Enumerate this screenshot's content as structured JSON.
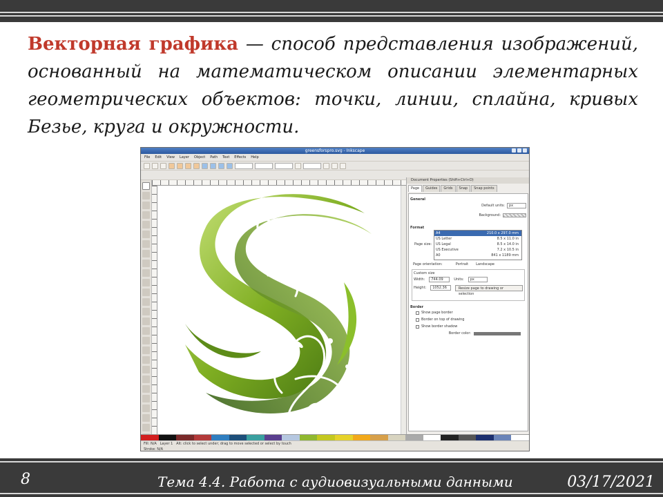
{
  "slide": {
    "term": "Векторная графика",
    "definition_rest": " — способ представления изображений, основанный на математическом описании элементарных геометрических объектов: точки, линии, сплайна, кривых Безье, круга и окружности.",
    "page_number": "8",
    "topic": "Тема 4.4. Работа с аудиовизуальными данными",
    "date": "03/17/2021",
    "accent_color": "#c0392b"
  },
  "screenshot": {
    "window_title": "greensforspro.svg - Inkscape",
    "menu": [
      "File",
      "Edit",
      "View",
      "Layer",
      "Object",
      "Path",
      "Text",
      "Effects",
      "Help"
    ],
    "dialog": {
      "title": "Document Properties (Shift+Ctrl+D)",
      "tabs": [
        "Page",
        "Guides",
        "Grids",
        "Snap",
        "Snap points"
      ],
      "general_label": "General",
      "default_units_label": "Default units:",
      "default_units_value": "px",
      "background_label": "Background:",
      "format_label": "Format",
      "page_size_label": "Page size:",
      "sizes": [
        {
          "name": "A4",
          "dims": "210.0 x 297.0 mm"
        },
        {
          "name": "US Letter",
          "dims": "8.5 x 11.0 in"
        },
        {
          "name": "US Legal",
          "dims": "8.5 x 14.0 in"
        },
        {
          "name": "US Executive",
          "dims": "7.2 x 10.5 in"
        },
        {
          "name": "A0",
          "dims": "841 x 1189 mm"
        }
      ],
      "orientation_label": "Page orientation:",
      "portrait": "Portrait",
      "landscape": "Landscape",
      "custom_size_label": "Custom size",
      "width_label": "Width:",
      "width_value": "744.09",
      "height_label": "Height:",
      "height_value": "1052.36",
      "units_label": "Units:",
      "units_value": "px",
      "resize_button": "Resize page to drawing or selection",
      "border_label": "Border",
      "show_border": "Show page border",
      "border_on_top": "Border on top of drawing",
      "show_shadow": "Show border shadow",
      "border_color_label": "Border color:"
    },
    "status_layer": "Layer 1",
    "status_text": "Alt: click to select under; drag to move selected or select by touch",
    "status_fill_label": "Fill:",
    "status_stroke_label": "Stroke:",
    "status_na": "N/A",
    "palette": [
      "#d21f1f",
      "#111111",
      "#7a2a2a",
      "#b33a3a",
      "#2f7ec0",
      "#1d4f7a",
      "#3aa0a0",
      "#5a3f8f",
      "#b5c7e0",
      "#90b830",
      "#c4c820",
      "#e6d22a",
      "#f2a91b",
      "#d7a04a",
      "#d8d4c0",
      "#aaaaaa",
      "#ffffff",
      "#222222",
      "#555555",
      "#1c2f6e",
      "#6a84b8",
      "#ffffff"
    ]
  }
}
